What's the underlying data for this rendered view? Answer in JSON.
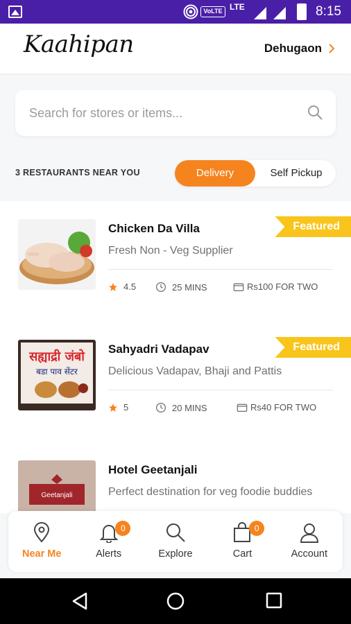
{
  "status_bar": {
    "network_badge": "VoLTE",
    "network_type": "LTE",
    "time": "8:15"
  },
  "header": {
    "app_name": "Kaahipan",
    "location": "Dehugaon"
  },
  "search": {
    "placeholder": "Search for stores or items..."
  },
  "listing": {
    "count_text": "3 RESTAURANTS NEAR YOU",
    "toggle": {
      "active": "Delivery",
      "inactive": "Self Pickup"
    }
  },
  "restaurants": [
    {
      "name": "Chicken Da Villa",
      "description": "Fresh Non - Veg Supplier",
      "rating": "4.5",
      "time": "25 MINS",
      "price": "Rs100 FOR TWO",
      "badge": "Featured"
    },
    {
      "name": "Sahyadri Vadapav",
      "description": "Delicious Vadapav, Bhaji and Pattis",
      "rating": "5",
      "time": "20 MINS",
      "price": "Rs40 FOR TWO",
      "badge": "Featured",
      "sign_text_1": "सह्याद्री जंबो",
      "sign_text_2": "बडा पाव सेंटर"
    },
    {
      "name": "Hotel Geetanjali",
      "description": "Perfect destination for veg foodie buddies",
      "sign_text": "Geetanjali"
    }
  ],
  "bottom_nav": {
    "items": [
      {
        "label": "Near Me",
        "icon": "map-pin-icon",
        "active": true
      },
      {
        "label": "Alerts",
        "icon": "bell-icon",
        "badge": "0"
      },
      {
        "label": "Explore",
        "icon": "search-icon"
      },
      {
        "label": "Cart",
        "icon": "shopping-bag-icon",
        "badge": "0"
      },
      {
        "label": "Account",
        "icon": "user-icon"
      }
    ]
  },
  "colors": {
    "status_bar": "#4a1fa8",
    "accent": "#f5841f",
    "featured": "#f9c51c"
  }
}
